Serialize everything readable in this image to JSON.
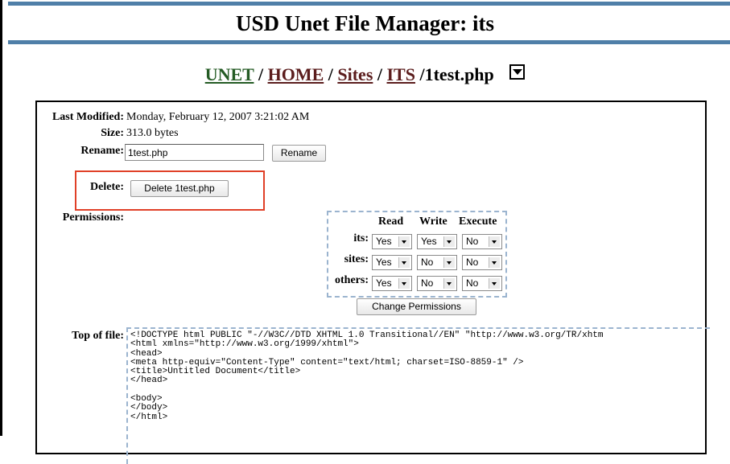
{
  "header": {
    "title": "USD Unet File Manager: its"
  },
  "breadcrumb": {
    "items": [
      "UNET",
      "HOME",
      "Sites",
      "ITS"
    ],
    "separator": "/",
    "current": "/1test.php",
    "menu_icon": "chevron-down-icon"
  },
  "file": {
    "last_modified_label": "Last Modified:",
    "last_modified": "Monday, February 12, 2007 3:21:02 AM",
    "size_label": "Size:",
    "size": "313.0 bytes",
    "rename_label": "Rename:",
    "rename_value": "1test.php",
    "rename_button": "Rename",
    "delete_label": "Delete:",
    "delete_button": "Delete 1test.php"
  },
  "permissions": {
    "label": "Permissions:",
    "columns": [
      "Read",
      "Write",
      "Execute"
    ],
    "rows": [
      {
        "name": "its:",
        "values": [
          "Yes",
          "Yes",
          "No"
        ]
      },
      {
        "name": "sites:",
        "values": [
          "Yes",
          "No",
          "No"
        ]
      },
      {
        "name": "others:",
        "values": [
          "Yes",
          "No",
          "No"
        ]
      }
    ],
    "button": "Change Permissions"
  },
  "preview": {
    "label": "Top of file:",
    "content": "<!DOCTYPE html PUBLIC \"-//W3C//DTD XHTML 1.0 Transitional//EN\" \"http://www.w3.org/TR/xhtm\n<html xmlns=\"http://www.w3.org/1999/xhtml\">\n<head>\n<meta http-equiv=\"Content-Type\" content=\"text/html; charset=ISO-8859-1\" />\n<title>Untitled Document</title>\n</head>\n\n<body>\n</body>\n</html>"
  },
  "colors": {
    "band": "#4f7fa8",
    "highlight": "#e04028",
    "dashed": "#9bb4cf",
    "link": "#5b1d1d",
    "root_link": "#245b24"
  }
}
